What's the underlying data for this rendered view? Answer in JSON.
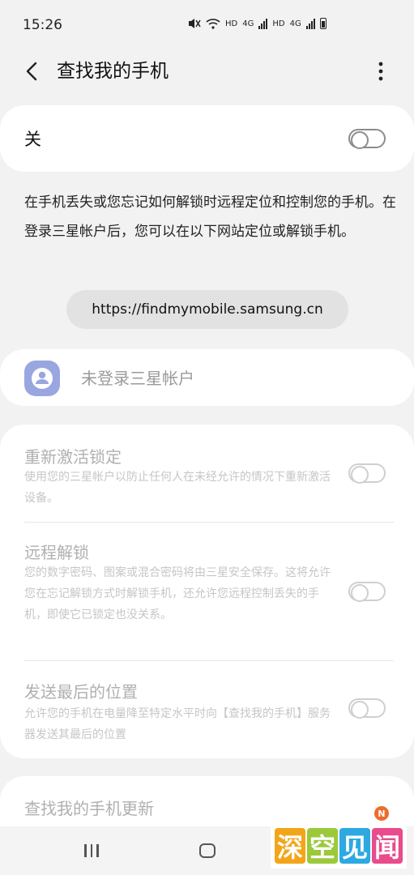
{
  "status_bar": {
    "time": "15:26",
    "hd_1": "HD",
    "net_1": "4G",
    "hd_2": "HD",
    "net_2": "4G"
  },
  "header": {
    "title": "查找我的手机",
    "back_icon": "chevron-left-icon",
    "more_icon": "more-vertical-icon"
  },
  "master_switch": {
    "label": "关",
    "on": false
  },
  "description": "在手机丢失或您忘记如何解锁时远程定位和控制您的手机。在登录三星帐户后，您可以在以下网站定位或解锁手机。",
  "url": "https://findmymobile.samsung.cn",
  "account": {
    "label": "未登录三星帐户",
    "icon": "account-avatar-icon"
  },
  "options": [
    {
      "title": "重新激活锁定",
      "desc": "使用您的三星帐户以防止任何人在未经允许的情况下重新激活设备。",
      "on": false
    },
    {
      "title": "远程解锁",
      "desc": "您的数字密码、图案或混合密码将由三星安全保存。这将允许您在忘记解锁方式时解锁手机，还允许您远程控制丢失的手机，即使它已锁定也没关系。",
      "on": false
    },
    {
      "title": "发送最后的位置",
      "desc": "允许您的手机在电量降至特定水平时向【查找我的手机】服务器发送其最后的位置",
      "on": false
    }
  ],
  "update": {
    "title": "查找我的手机更新",
    "badge": "N"
  },
  "watermark": {
    "chars": [
      "深",
      "空",
      "见",
      "闻"
    ],
    "colors": [
      "#f3a51a",
      "#9bc93a",
      "#2da9e1",
      "#e94b8c"
    ]
  },
  "colors": {
    "background": "#f2f2f2",
    "card": "#ffffff",
    "avatar": "#9aa6df",
    "badge": "#ef6c2f"
  }
}
